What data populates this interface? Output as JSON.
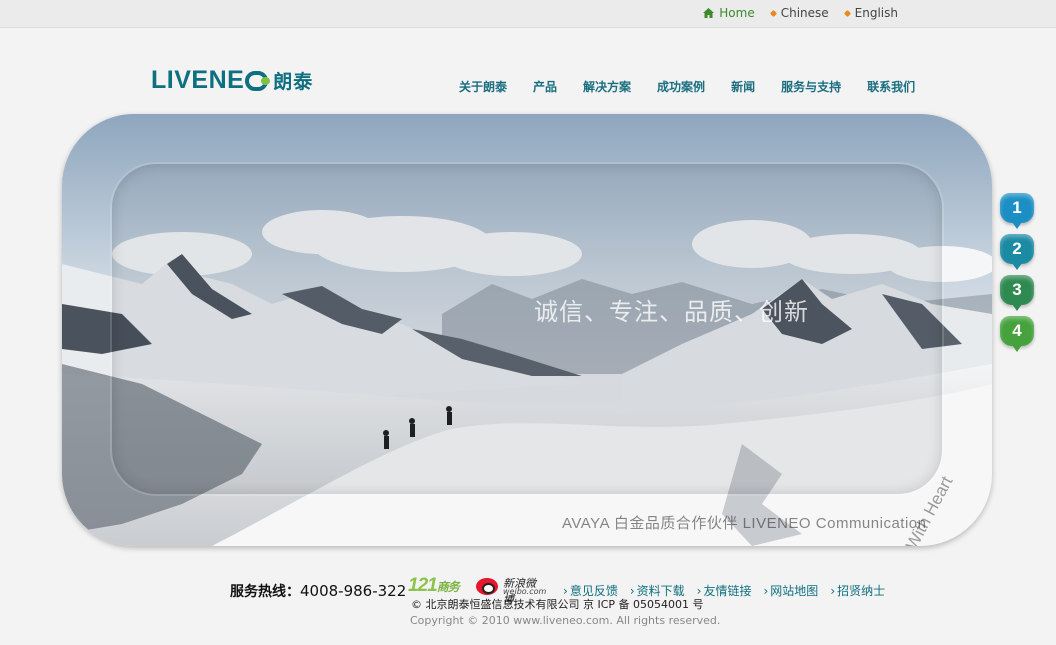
{
  "topbar": {
    "links": [
      {
        "label": "Home"
      },
      {
        "label": "Chinese"
      },
      {
        "label": "English"
      }
    ]
  },
  "logo": {
    "latin": "LIVENE",
    "cn": "朗泰"
  },
  "nav": {
    "items": [
      "关于朗泰",
      "产品",
      "解决方案",
      "成功案例",
      "新闻",
      "服务与支持",
      "联系我们"
    ]
  },
  "hero": {
    "slogan": "诚信、专注、品质、创新",
    "caption": "AVAYA 白金品质合作伙伴  LIVENEO Communication",
    "side_text": "With Heart"
  },
  "slides": [
    {
      "label": "1",
      "color": "#1b8fc4"
    },
    {
      "label": "2",
      "color": "#1b8aa3"
    },
    {
      "label": "3",
      "color": "#2f8a52"
    },
    {
      "label": "4",
      "color": "#45a23c"
    }
  ],
  "footer": {
    "hotline_label": "服务热线：",
    "hotline_number": "4008-986-322",
    "logo121": "121",
    "logo121_cn": "商务",
    "weibo_cn": "新浪微博",
    "weibo_en": "weibo.com",
    "links": [
      "意见反馈",
      "资料下载",
      "友情链接",
      "网站地图",
      "招贤纳士"
    ],
    "company": "© 北京朗泰恒盛信息技术有限公司    京 ICP 备 05054001 号",
    "copyright": "Copyright © 2010 www.liveneo.com. All rights reserved."
  }
}
